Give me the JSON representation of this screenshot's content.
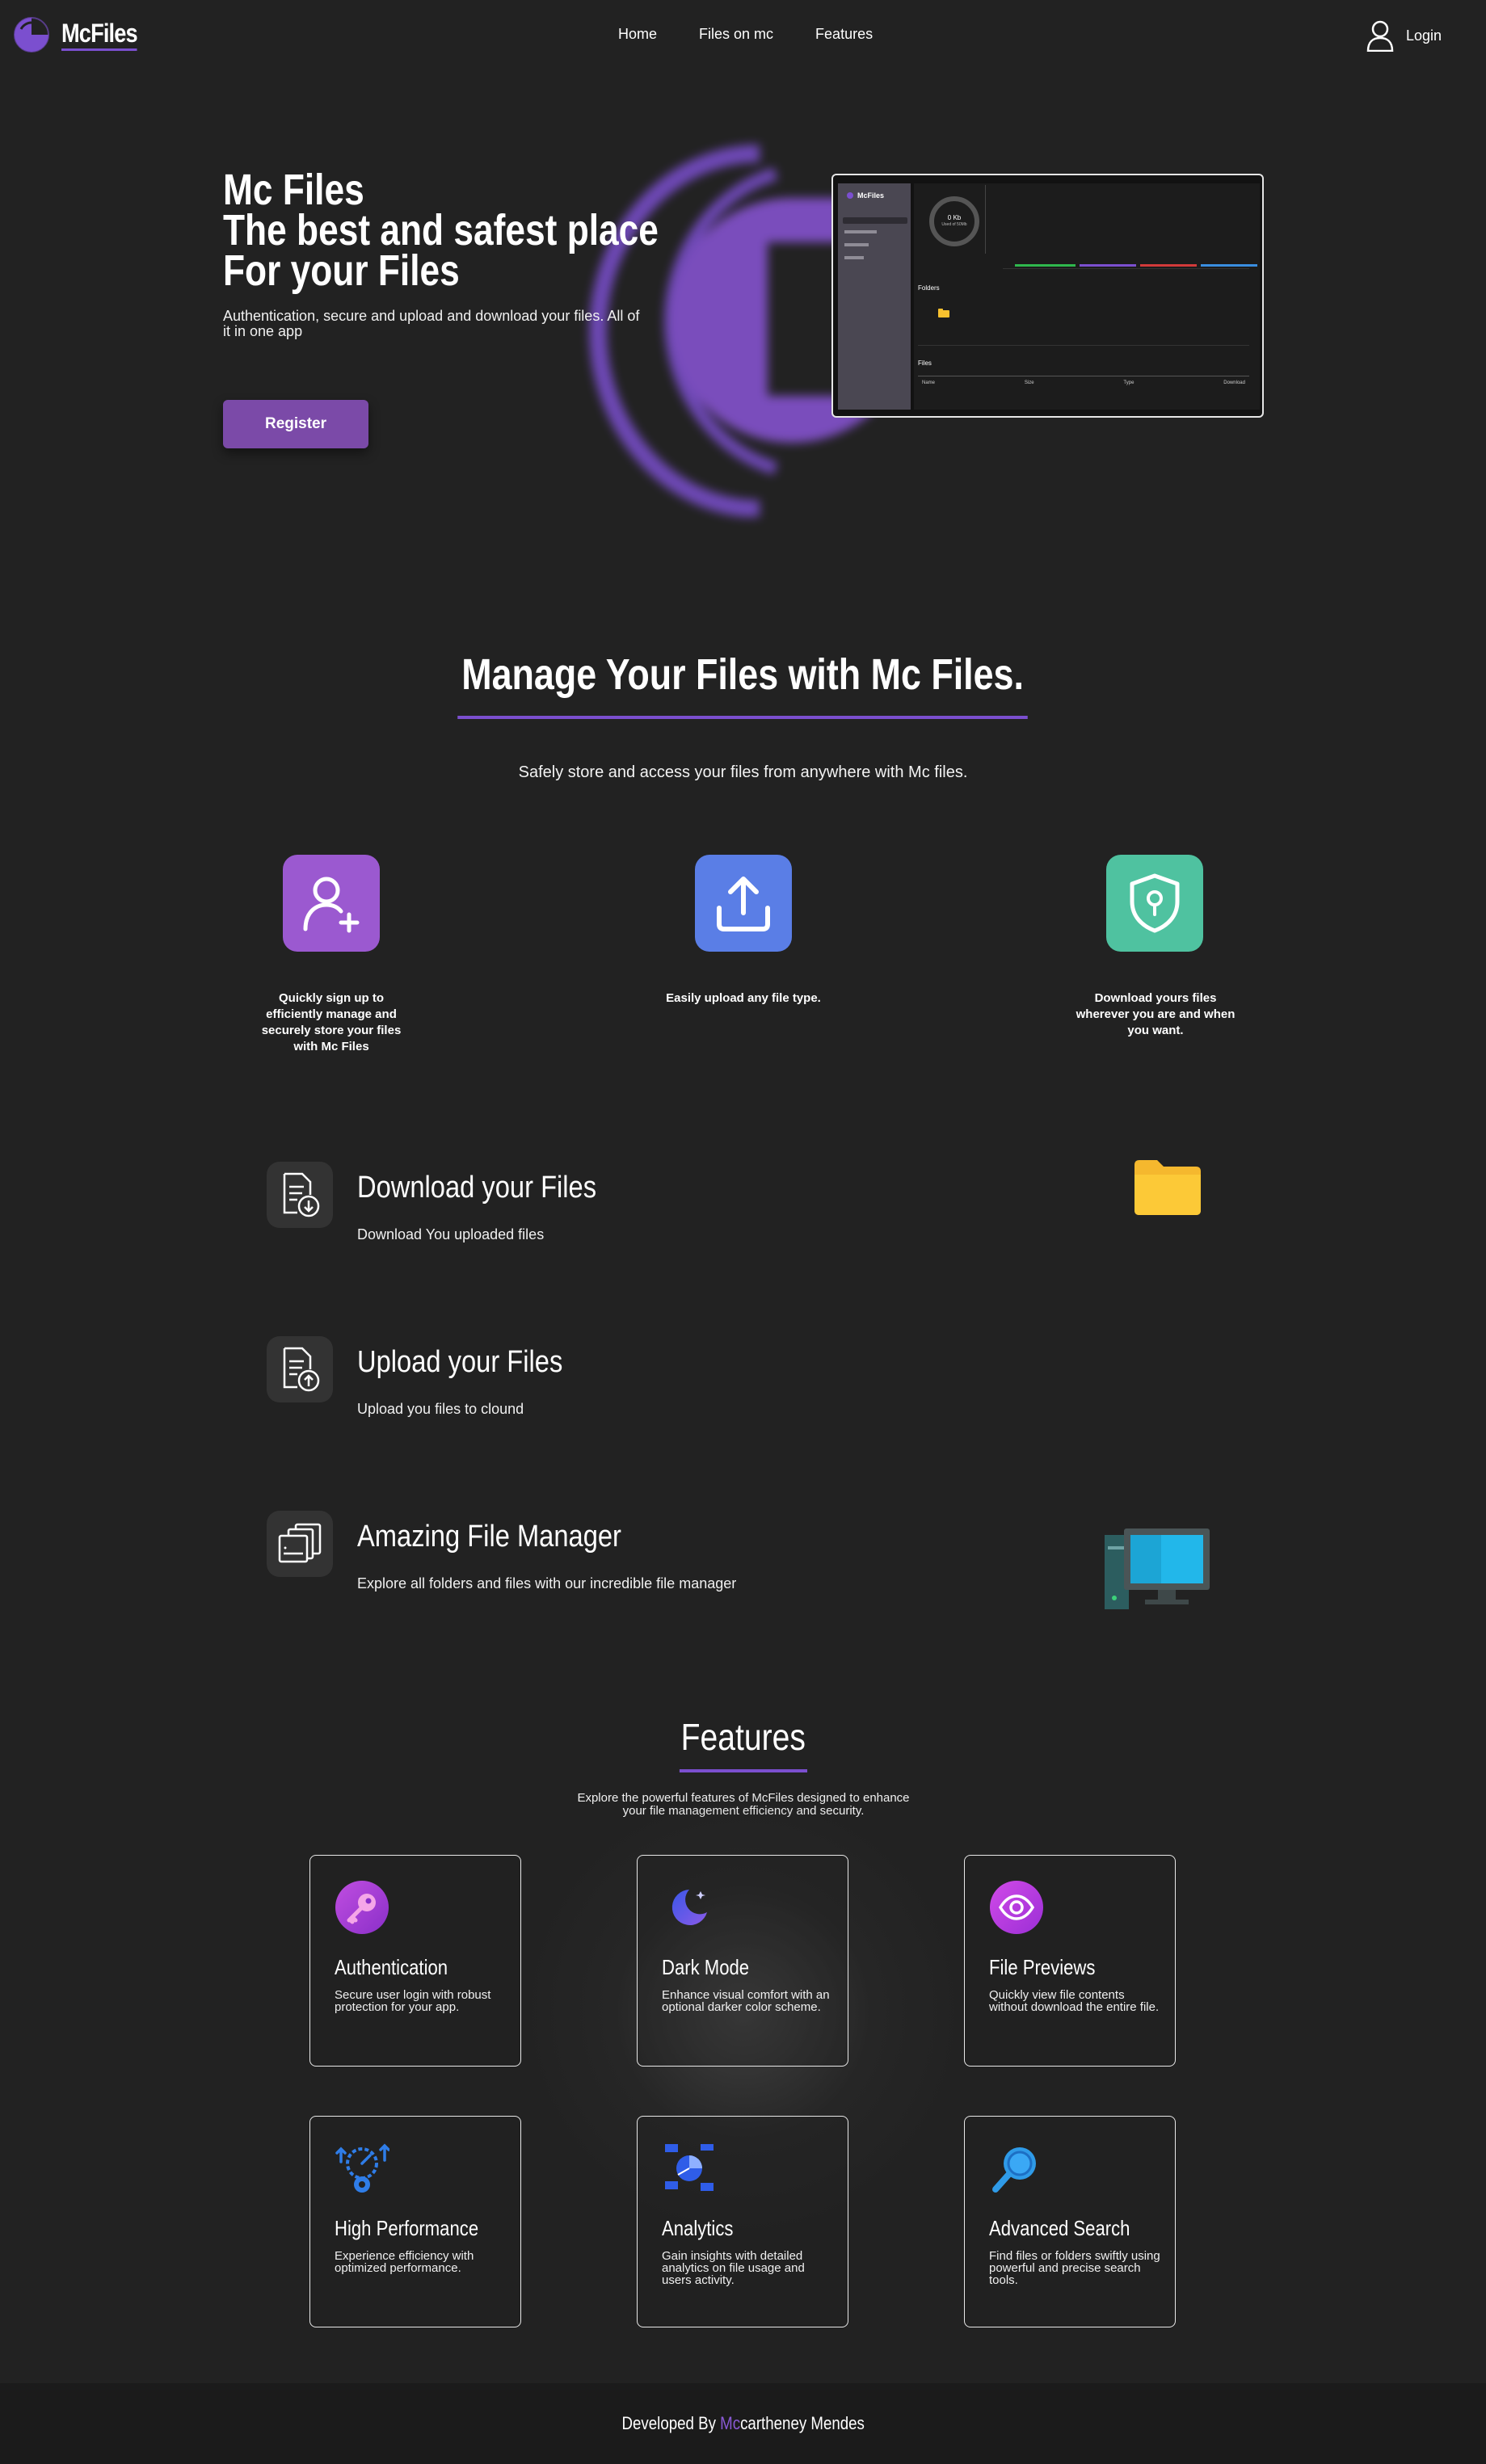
{
  "nav": {
    "brand": "McFiles",
    "links": [
      "Home",
      "Files on mc",
      "Features"
    ],
    "login_label": "Login"
  },
  "hero": {
    "title_lines": [
      "Mc Files",
      "The best and safest place",
      "For your Files"
    ],
    "subtitle": "Authentication, secure and upload and download your files. All of it in one app",
    "register_label": "Register",
    "preview": {
      "brand": "McFiles",
      "storage_value": "0 Kb",
      "storage_sub": "Used of 50Mb",
      "folders_label": "Folders",
      "files_label": "Files",
      "file_columns": [
        "Name",
        "Size",
        "Type",
        "Download"
      ]
    }
  },
  "manage": {
    "title": "Manage Your Files with Mc Files.",
    "subtitle": "Safely store and access your files from anywhere with Mc files.",
    "cards": [
      {
        "icon": "user-plus-icon",
        "text": "Quickly sign up to efficiently manage and securely store your files with Mc Files",
        "color": "#9b59d0"
      },
      {
        "icon": "upload-icon",
        "text": "Easily upload any file type.",
        "color": "#5a7ee6"
      },
      {
        "icon": "shield-lock-icon",
        "text": "Download yours files wherever you are and when you want.",
        "color": "#4fc2a0"
      }
    ]
  },
  "feature_rows": [
    {
      "icon": "file-download-icon",
      "title": "Download your Files",
      "desc": "Download You uploaded files"
    },
    {
      "icon": "file-upload-icon",
      "title": "Upload your Files",
      "desc": "Upload you files to clound"
    },
    {
      "icon": "file-manager-icon",
      "title": "Amazing File Manager",
      "desc": "Explore all folders and files with our incredible file manager"
    }
  ],
  "features": {
    "title": "Features",
    "subtitle": "Explore the powerful features of McFiles designed to enhance your file management efficiency and security.",
    "cards": [
      {
        "icon": "key-icon",
        "title": "Authentication",
        "desc": "Secure user login with robust protection for your app."
      },
      {
        "icon": "moon-icon",
        "title": "Dark Mode",
        "desc": "Enhance visual comfort with an optional darker color scheme."
      },
      {
        "icon": "eye-icon",
        "title": "File Previews",
        "desc": "Quickly view file contents without download the entire file."
      },
      {
        "icon": "performance-icon",
        "title": "High Performance",
        "desc": "Experience efficiency with optimized performance."
      },
      {
        "icon": "analytics-icon",
        "title": "Analytics",
        "desc": "Gain insights with detailed analytics on file usage and users activity."
      },
      {
        "icon": "magnifier-icon",
        "title": "Advanced Search",
        "desc": "Find files or folders swiftly using powerful and precise search tools."
      }
    ]
  },
  "footer": {
    "prefix": "Developed By ",
    "accent": "Mc",
    "suffix": "cartheney Mendes"
  },
  "colors": {
    "background": "#222222",
    "accent": "#7b4fcf",
    "register_button": "#7b4aa8"
  }
}
